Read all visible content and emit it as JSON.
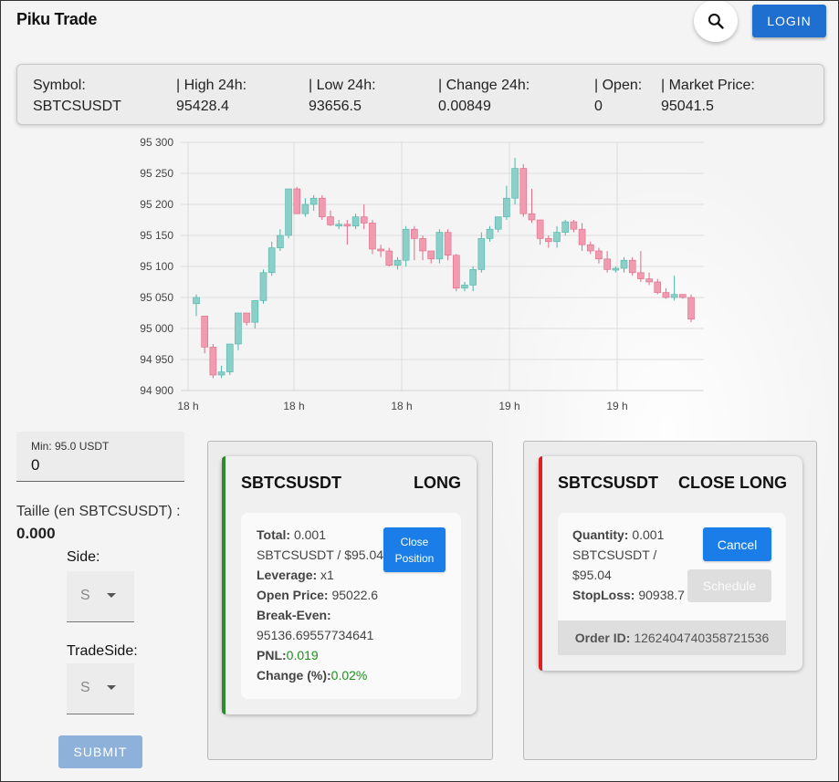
{
  "app": {
    "title": "Piku Trade",
    "login_label": "LOGIN"
  },
  "stats": [
    {
      "label": "Symbol:",
      "value": "SBTCSUSDT"
    },
    {
      "label": "| High 24h:",
      "value": "95428.4"
    },
    {
      "label": "| Low 24h:",
      "value": "93656.5"
    },
    {
      "label": "| Change 24h:",
      "value": "0.00849"
    },
    {
      "label": "| Open:",
      "value": "0"
    },
    {
      "label": "| Market Price:",
      "value": "95041.5"
    }
  ],
  "chart_data": {
    "type": "candlestick",
    "y_ticks": [
      "95 300",
      "95 250",
      "95 200",
      "95 150",
      "95 100",
      "95 050",
      "95 000",
      "94 950",
      "94 900"
    ],
    "x_ticks": [
      "18 h",
      "18 h",
      "18 h",
      "19 h",
      "19 h"
    ],
    "ylim": [
      94900,
      95300
    ],
    "up_color": "#8ad0c8",
    "down_color": "#f19bb0",
    "candles": [
      [
        95040,
        95050,
        95020,
        95055
      ],
      [
        95020,
        94970,
        94960,
        95020
      ],
      [
        94970,
        94925,
        94920,
        94975
      ],
      [
        94925,
        94930,
        94920,
        94940
      ],
      [
        94930,
        94975,
        94925,
        94975
      ],
      [
        94975,
        95025,
        94965,
        95025
      ],
      [
        95025,
        95010,
        95005,
        95025
      ],
      [
        95010,
        95045,
        95000,
        95045
      ],
      [
        95045,
        95090,
        95040,
        95095
      ],
      [
        95090,
        95130,
        95085,
        95140
      ],
      [
        95130,
        95150,
        95125,
        95160
      ],
      [
        95150,
        95225,
        95145,
        95225
      ],
      [
        95225,
        95185,
        95185,
        95228
      ],
      [
        95185,
        95200,
        95180,
        95210
      ],
      [
        95200,
        95210,
        95190,
        95215
      ],
      [
        95210,
        95180,
        95175,
        95215
      ],
      [
        95180,
        95167,
        95165,
        95190
      ],
      [
        95167,
        95168,
        95160,
        95175
      ],
      [
        95168,
        95165,
        95135,
        95175
      ],
      [
        95165,
        95180,
        95160,
        95185
      ],
      [
        95180,
        95170,
        95160,
        95200
      ],
      [
        95170,
        95128,
        95120,
        95175
      ],
      [
        95128,
        95125,
        95115,
        95135
      ],
      [
        95125,
        95102,
        95100,
        95130
      ],
      [
        95102,
        95110,
        95095,
        95115
      ],
      [
        95110,
        95160,
        95100,
        95165
      ],
      [
        95160,
        95145,
        95110,
        95165
      ],
      [
        95145,
        95125,
        95110,
        95150
      ],
      [
        95125,
        95112,
        95105,
        95125
      ],
      [
        95112,
        95155,
        95105,
        95160
      ],
      [
        95155,
        95118,
        95110,
        95160
      ],
      [
        95118,
        95065,
        95060,
        95120
      ],
      [
        95065,
        95070,
        95060,
        95075
      ],
      [
        95070,
        95095,
        95060,
        95100
      ],
      [
        95095,
        95145,
        95090,
        95155
      ],
      [
        95145,
        95160,
        95140,
        95165
      ],
      [
        95160,
        95180,
        95155,
        95180
      ],
      [
        95180,
        95210,
        95175,
        95230
      ],
      [
        95210,
        95258,
        95200,
        95275
      ],
      [
        95258,
        95185,
        95180,
        95265
      ],
      [
        95185,
        95175,
        95170,
        95225
      ],
      [
        95175,
        95145,
        95135,
        95175
      ],
      [
        95145,
        95140,
        95130,
        95150
      ],
      [
        95140,
        95155,
        95130,
        95165
      ],
      [
        95155,
        95172,
        95150,
        95175
      ],
      [
        95172,
        95160,
        95155,
        95175
      ],
      [
        95160,
        95135,
        95125,
        95170
      ],
      [
        95135,
        95125,
        95120,
        95140
      ],
      [
        95125,
        95112,
        95105,
        95130
      ],
      [
        95112,
        95095,
        95090,
        95125
      ],
      [
        95095,
        95097,
        95090,
        95100
      ],
      [
        95097,
        95110,
        95090,
        95115
      ],
      [
        95110,
        95090,
        95085,
        95115
      ],
      [
        95090,
        95080,
        95075,
        95125
      ],
      [
        95080,
        95075,
        95070,
        95090
      ],
      [
        95075,
        95058,
        95055,
        95080
      ],
      [
        95058,
        95050,
        95048,
        95065
      ],
      [
        95050,
        95055,
        95045,
        95085
      ],
      [
        95055,
        95050,
        95048,
        95055
      ],
      [
        95050,
        95015,
        95010,
        95055
      ]
    ]
  },
  "form": {
    "min_label": "Min: 95.0 USDT",
    "amount_value": "0",
    "taille_label": "Taille (en SBTCSUSDT) :",
    "taille_value": "0.000",
    "side_label": "Side:",
    "side_value": "S",
    "tradeside_label": "TradeSide:",
    "tradeside_value": "S",
    "submit_label": "SUBMIT"
  },
  "position": {
    "symbol": "SBTCSUSDT",
    "side": "LONG",
    "total_label": "Total:",
    "total_value": "0.001",
    "total_line2": "SBTCSUSDT / $95.04",
    "leverage_label": "Leverage:",
    "leverage_value": "x1",
    "open_label": "Open Price:",
    "open_value": "95022.6",
    "breakeven_label": "Break-Even:",
    "breakeven_value": "95136.69557734641",
    "pnl_label": "PNL:",
    "pnl_value": "0.019",
    "change_label": "Change (%):",
    "change_value": "0.02%",
    "close_label_1": "Close",
    "close_label_2": "Position",
    "accent": "#2e8b2e"
  },
  "order": {
    "symbol": "SBTCSUSDT",
    "side": "CLOSE LONG",
    "qty_label": "Quantity:",
    "qty_value": "0.001",
    "qty_line2": "SBTCSUSDT /",
    "qty_line3": "$95.04",
    "stoploss_label": "StopLoss:",
    "stoploss_value": "90938.7",
    "cancel_label": "Cancel",
    "schedule_label": "Schedule",
    "order_id_label": "Order ID:",
    "order_id_value": "1262404740358721536",
    "accent": "#e02020"
  }
}
